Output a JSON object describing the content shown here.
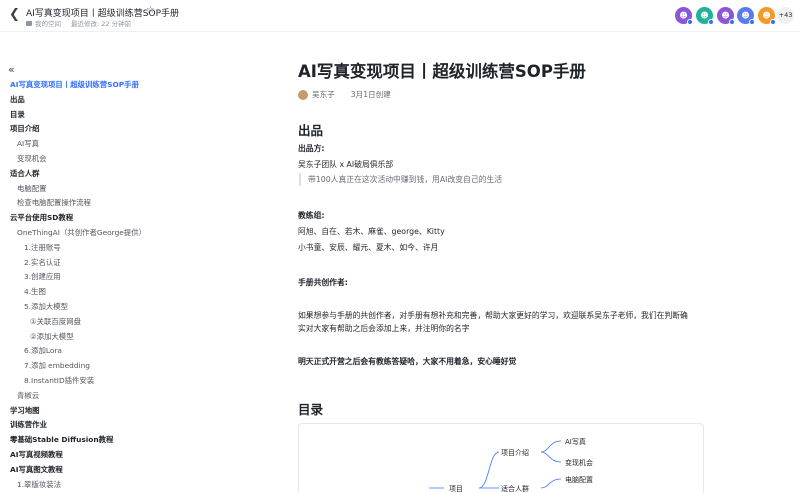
{
  "topbar": {
    "title": "AI写真变现项目丨超级训练营SOP手册",
    "location": "我的空间",
    "modified": "最近修改: 22 分钟前",
    "more_count": "+43",
    "avatar_colors": [
      "#8a58d6",
      "#1fb39b",
      "#8a58d6",
      "#5b7cf0",
      "#f59a23"
    ]
  },
  "outline": {
    "items": [
      {
        "label": "AI写真变现项目丨超级训练营SOP手册",
        "level": 1,
        "active": true
      },
      {
        "label": "出品",
        "level": 1
      },
      {
        "label": "目录",
        "level": 1
      },
      {
        "label": "项目介绍",
        "level": 1
      },
      {
        "label": "AI写真",
        "level": 2
      },
      {
        "label": "变现机会",
        "level": 2
      },
      {
        "label": "适合人群",
        "level": 1
      },
      {
        "label": "电脑配置",
        "level": 2
      },
      {
        "label": "检查电脑配置操作流程",
        "level": 2
      },
      {
        "label": "云平台使用SD教程",
        "level": 1
      },
      {
        "label": "OneThingAI（共创作者George提供）",
        "level": 2
      },
      {
        "label": "1.注册账号",
        "level": 3
      },
      {
        "label": "2.实名认证",
        "level": 3
      },
      {
        "label": "3.创建应用",
        "level": 3
      },
      {
        "label": "4.生图",
        "level": 3
      },
      {
        "label": "5.添加大模型",
        "level": 3
      },
      {
        "label": "①关联百度网盘",
        "level": 4
      },
      {
        "label": "②添加大模型",
        "level": 4
      },
      {
        "label": "6.添加Lora",
        "level": 3
      },
      {
        "label": "7.添加 embedding",
        "level": 3
      },
      {
        "label": "8.InstantID插件安装",
        "level": 3
      },
      {
        "label": "青椒云",
        "level": 2
      },
      {
        "label": "学习地图",
        "level": 1
      },
      {
        "label": "训练营作业",
        "level": 1
      },
      {
        "label": "零基础Stable Diffusion教程",
        "level": 1
      },
      {
        "label": "AI写真视频教程",
        "level": 1
      },
      {
        "label": "AI写真图文教程",
        "level": 1
      },
      {
        "label": "1.翠版妆装法",
        "level": 2
      }
    ]
  },
  "doc": {
    "title": "AI写真变现项目丨超级训练营SOP手册",
    "author": "吴东子",
    "created": "3月1日创建",
    "section_output": "出品",
    "producer_label": "出品方:",
    "producer_value": "吴东子团队 x AI破局俱乐部",
    "quote": "带100人真正在这次活动中赚到钱，用AI改变自己的生活",
    "coaches_label": "教练组:",
    "coaches_line1": "阿旭、自在、若木、麻雀、george、Kitty",
    "coaches_line2": "小书童、安辰、耀元、夏木、如今、许月",
    "cocreators_label": "手册共创作者:",
    "para1_line1": "如果想参与手册的共创作者，对手册有想补充和完善，帮助大家更好的学习，欢迎联系吴东子老师，我们在判断确",
    "para1_line2": "实对大家有帮助之后会添加上来，并注明你的名字",
    "bold_note": "明天正式开营之后会有教练答疑哈，大家不用着急，安心睡好觉",
    "section_toc": "目录"
  },
  "mindmap": {
    "root": "项目",
    "nodes": [
      "项目介绍",
      "适合人群"
    ],
    "leaves": [
      "AI写真",
      "变现机会",
      "电脑配置"
    ]
  }
}
